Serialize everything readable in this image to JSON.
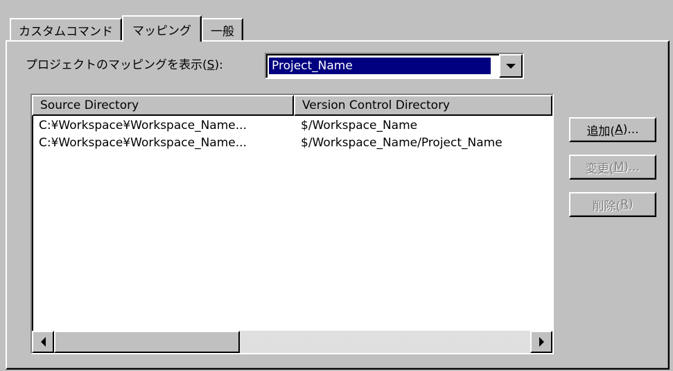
{
  "tabs": [
    {
      "label": "カスタムコマンド",
      "active": false
    },
    {
      "label": "マッピング",
      "active": true
    },
    {
      "label": "一般",
      "active": false
    }
  ],
  "project_mapping": {
    "label_prefix": "プロジェクトのマッピングを表示(",
    "label_accel": "S",
    "label_suffix": "):",
    "selected": "Project_Name"
  },
  "list": {
    "columns": [
      "Source Directory",
      "Version Control Directory"
    ],
    "rows": [
      [
        "C:¥Workspace¥Workspace_Name...",
        "$/Workspace_Name"
      ],
      [
        "C:¥Workspace¥Workspace_Name...",
        "$/Workspace_Name/Project_Name"
      ]
    ]
  },
  "buttons": {
    "add": {
      "prefix": "追加(",
      "accel": "A",
      "suffix": ")...",
      "enabled": true
    },
    "change": {
      "prefix": "変更(",
      "accel": "M",
      "suffix": ")...",
      "enabled": false
    },
    "delete": {
      "prefix": "削除(",
      "accel": "R",
      "suffix": ")",
      "enabled": false
    }
  }
}
